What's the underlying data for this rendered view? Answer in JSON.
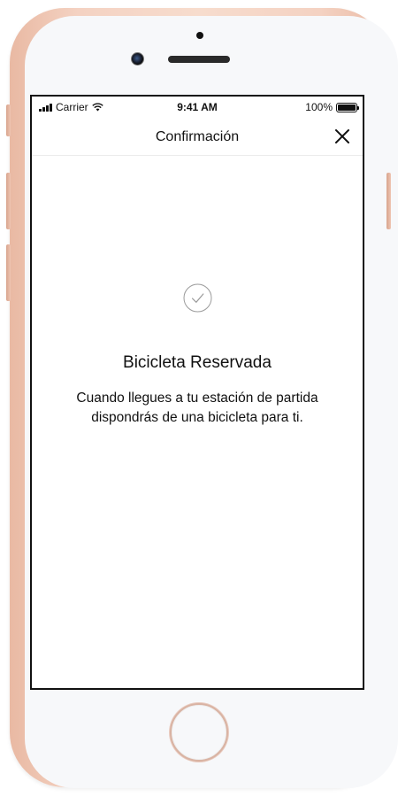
{
  "status_bar": {
    "carrier": "Carrier",
    "time": "9:41 AM",
    "battery": "100%",
    "icons": [
      "signal-icon",
      "wifi-icon",
      "battery-icon"
    ]
  },
  "navbar": {
    "title": "Confirmación",
    "close_icon": "close-icon"
  },
  "confirmation": {
    "icon": "checkmark-circle-icon",
    "title": "Bicicleta Reservada",
    "description": "Cuando llegues a tu estación de partida dispondrás de una bicicleta para ti."
  },
  "colors": {
    "device_frame": "#f4d2c2",
    "screen_bg": "#ffffff",
    "text": "#111111",
    "icon_gray": "#9a9a9a"
  }
}
